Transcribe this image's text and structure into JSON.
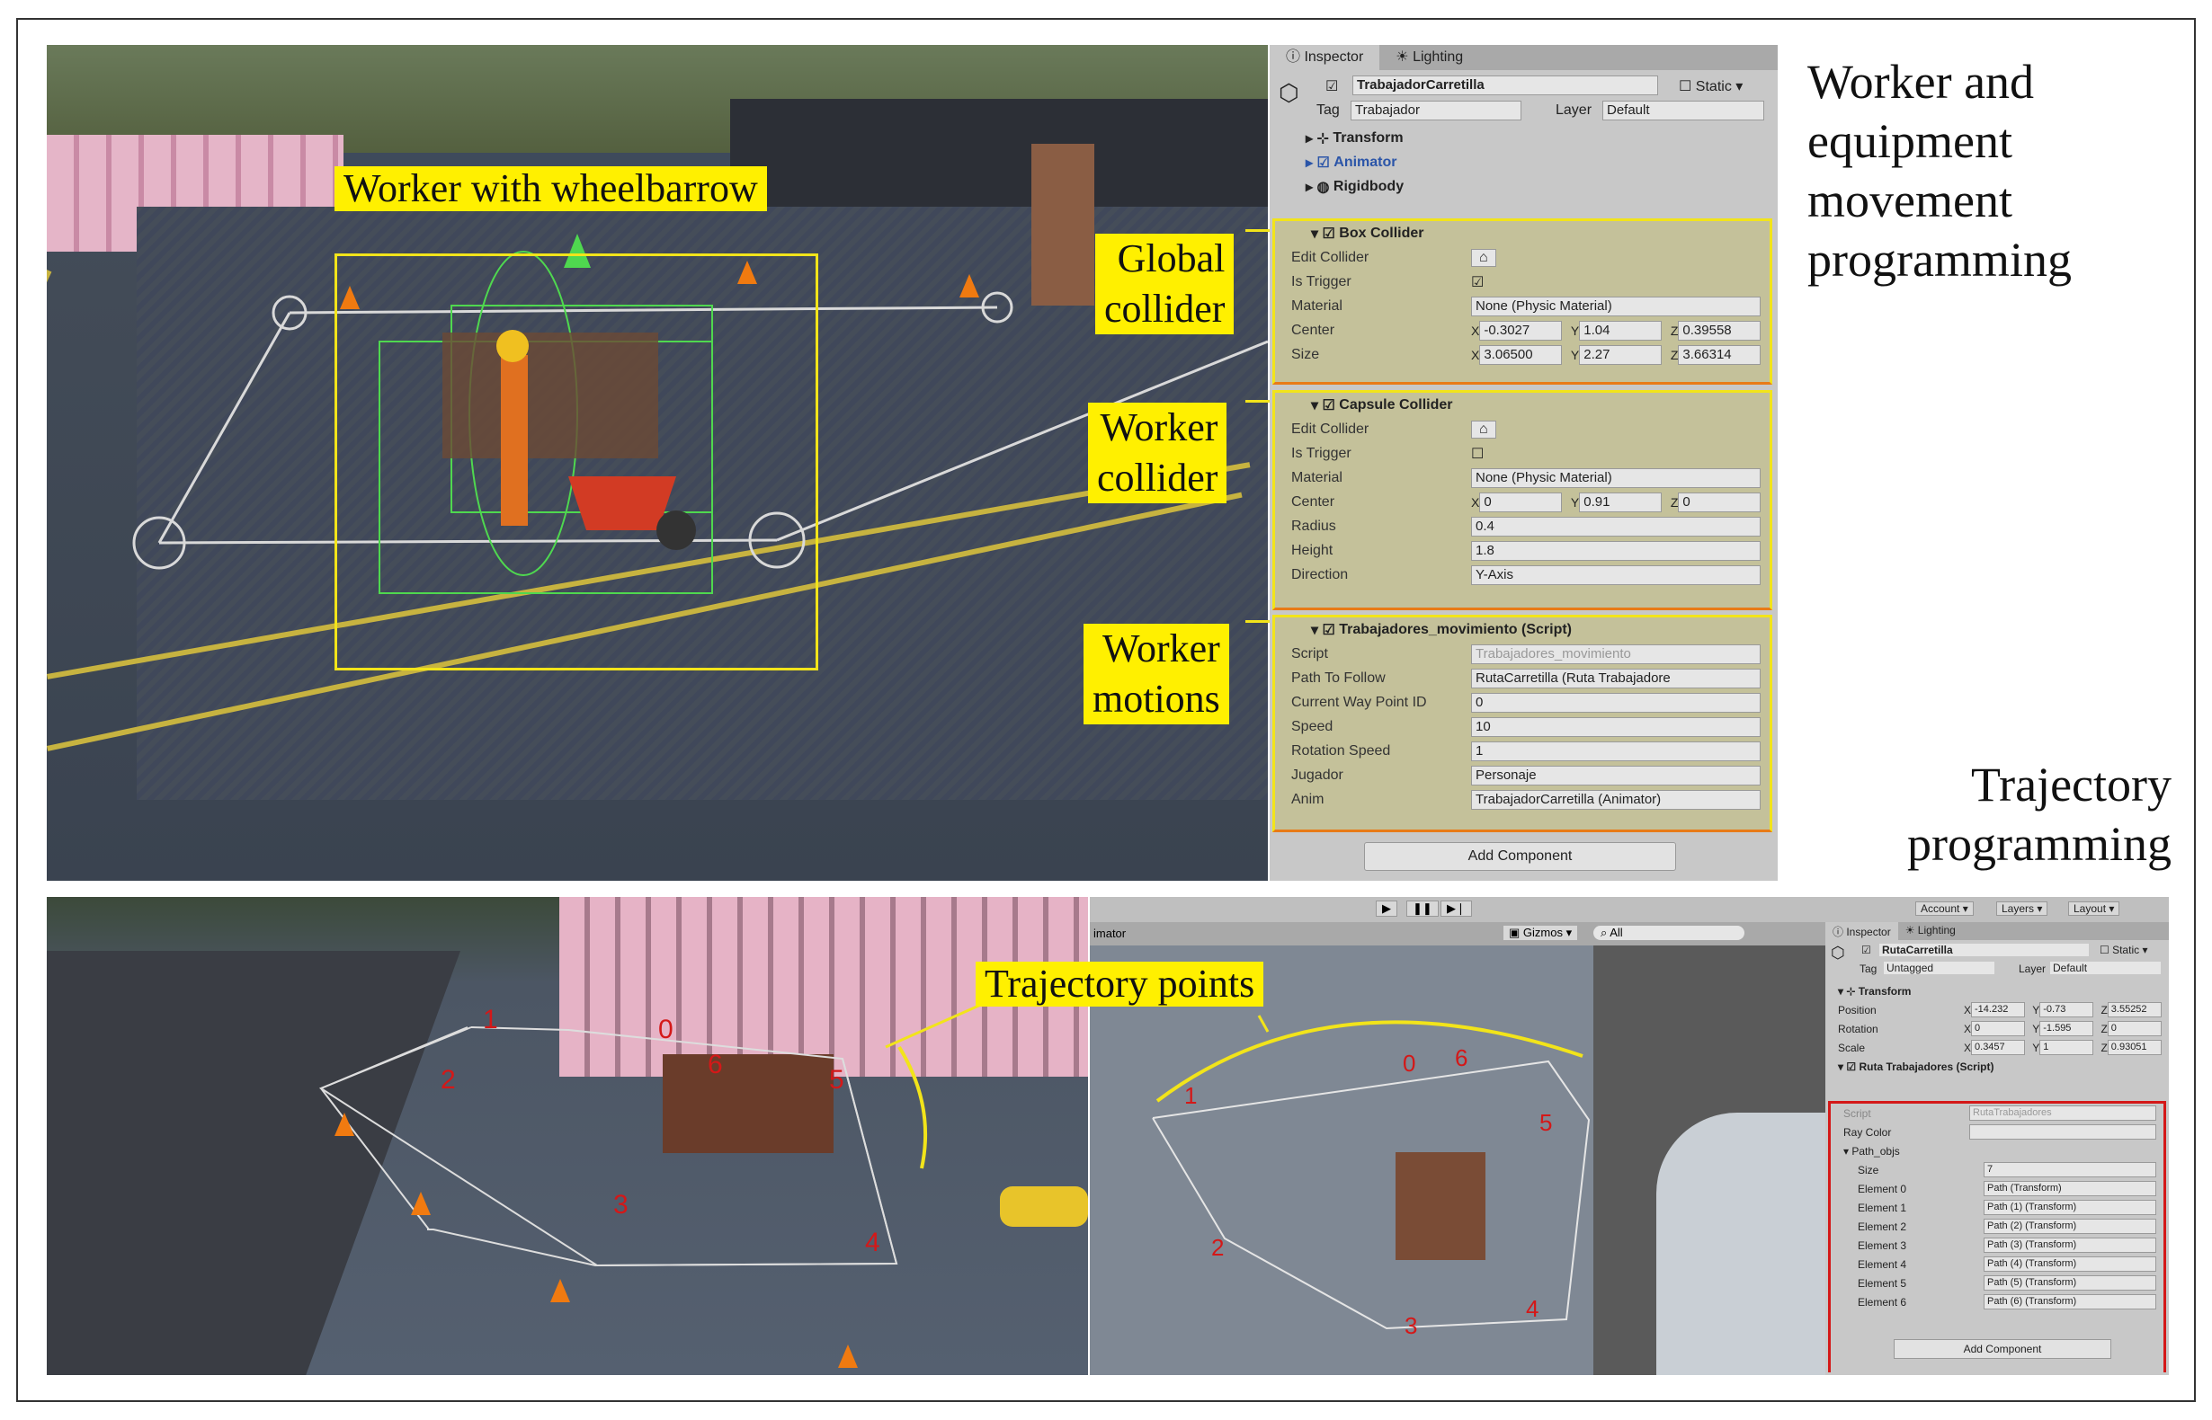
{
  "labels": {
    "worker_with_wheelbarrow": "Worker with wheelbarrow",
    "global_collider": [
      "Global",
      "collider"
    ],
    "worker_collider": [
      "Worker",
      "collider"
    ],
    "worker_motions": [
      "Worker",
      "motions"
    ],
    "trajectory_points": "Trajectory points"
  },
  "titles": {
    "movement": [
      "Worker and",
      "equipment",
      "movement",
      "programming"
    ],
    "trajectory": [
      "Trajectory",
      "programming"
    ]
  },
  "inspector_top": {
    "tabs": [
      "Inspector",
      "Lighting"
    ],
    "object_name": "TrabajadorCarretilla",
    "static_label": "Static",
    "tag_label": "Tag",
    "tag_value": "Trabajador",
    "layer_label": "Layer",
    "layer_value": "Default",
    "components": [
      "Transform",
      "Animator",
      "Rigidbody"
    ],
    "box_collider": {
      "title": "Box Collider",
      "edit_collider": "Edit Collider",
      "is_trigger": "Is Trigger",
      "material_label": "Material",
      "material": "None (Physic Material)",
      "center_label": "Center",
      "center": {
        "x": "-0.3027",
        "y": "1.04",
        "z": "0.39558"
      },
      "size_label": "Size",
      "size": {
        "x": "3.06500",
        "y": "2.27",
        "z": "3.66314"
      }
    },
    "capsule_collider": {
      "title": "Capsule Collider",
      "edit_collider": "Edit Collider",
      "is_trigger": "Is Trigger",
      "material_label": "Material",
      "material": "None (Physic Material)",
      "center_label": "Center",
      "center": {
        "x": "0",
        "y": "0.91",
        "z": "0"
      },
      "radius_label": "Radius",
      "radius": "0.4",
      "height_label": "Height",
      "height": "1.8",
      "direction_label": "Direction",
      "direction": "Y-Axis"
    },
    "script": {
      "title": "Trabajadores_movimiento (Script)",
      "script_label": "Script",
      "script_value": "Trabajadores_movimiento",
      "path_label": "Path To Follow",
      "path_value": "RutaCarretilla (Ruta Trabajadore",
      "waypoint_label": "Current Way Point ID",
      "waypoint_value": "0",
      "speed_label": "Speed",
      "speed_value": "10",
      "rot_label": "Rotation Speed",
      "rot_value": "1",
      "jugador_label": "Jugador",
      "jugador_value": "Personaje",
      "anim_label": "Anim",
      "anim_value": "TrabajadorCarretilla (Animator)"
    },
    "add_component": "Add Component"
  },
  "editor_bottom": {
    "toolbar": [
      "Account",
      "Layers",
      "Layout"
    ],
    "scene_tab": "imator",
    "gizmos": "Gizmos",
    "search_placeholder": "All"
  },
  "inspector_bottom": {
    "tabs": [
      "Inspector",
      "Lighting"
    ],
    "object_name": "RutaCarretilla",
    "static_label": "Static",
    "tag_label": "Tag",
    "tag_value": "Untagged",
    "layer_label": "Layer",
    "layer_value": "Default",
    "transform_title": "Transform",
    "position_label": "Position",
    "position": {
      "x": "-14.232",
      "y": "-0.73",
      "z": "3.55252"
    },
    "rotation_label": "Rotation",
    "rotation": {
      "x": "0",
      "y": "-1.595",
      "z": "0"
    },
    "scale_label": "Scale",
    "scale": {
      "x": "0.3457",
      "y": "1",
      "z": "0.93051"
    },
    "script_title": "Ruta Trabajadores (Script)",
    "script_label": "Script",
    "script_value": "RutaTrabajadores",
    "ray_color_label": "Ray Color",
    "path_objs_label": "Path_objs",
    "size_label": "Size",
    "size_value": "7",
    "elements": [
      {
        "name": "Element 0",
        "value": "Path (Transform)"
      },
      {
        "name": "Element 1",
        "value": "Path (1) (Transform)"
      },
      {
        "name": "Element 2",
        "value": "Path (2) (Transform)"
      },
      {
        "name": "Element 3",
        "value": "Path (3) (Transform)"
      },
      {
        "name": "Element 4",
        "value": "Path (4) (Transform)"
      },
      {
        "name": "Element 5",
        "value": "Path (5) (Transform)"
      },
      {
        "name": "Element 6",
        "value": "Path (6) (Transform)"
      }
    ],
    "add_component": "Add Component"
  },
  "trajectory_numbers": [
    "0",
    "1",
    "2",
    "3",
    "4",
    "5",
    "6"
  ],
  "colors": {
    "highlight": "#fff000",
    "trajectory": "#d41818"
  }
}
